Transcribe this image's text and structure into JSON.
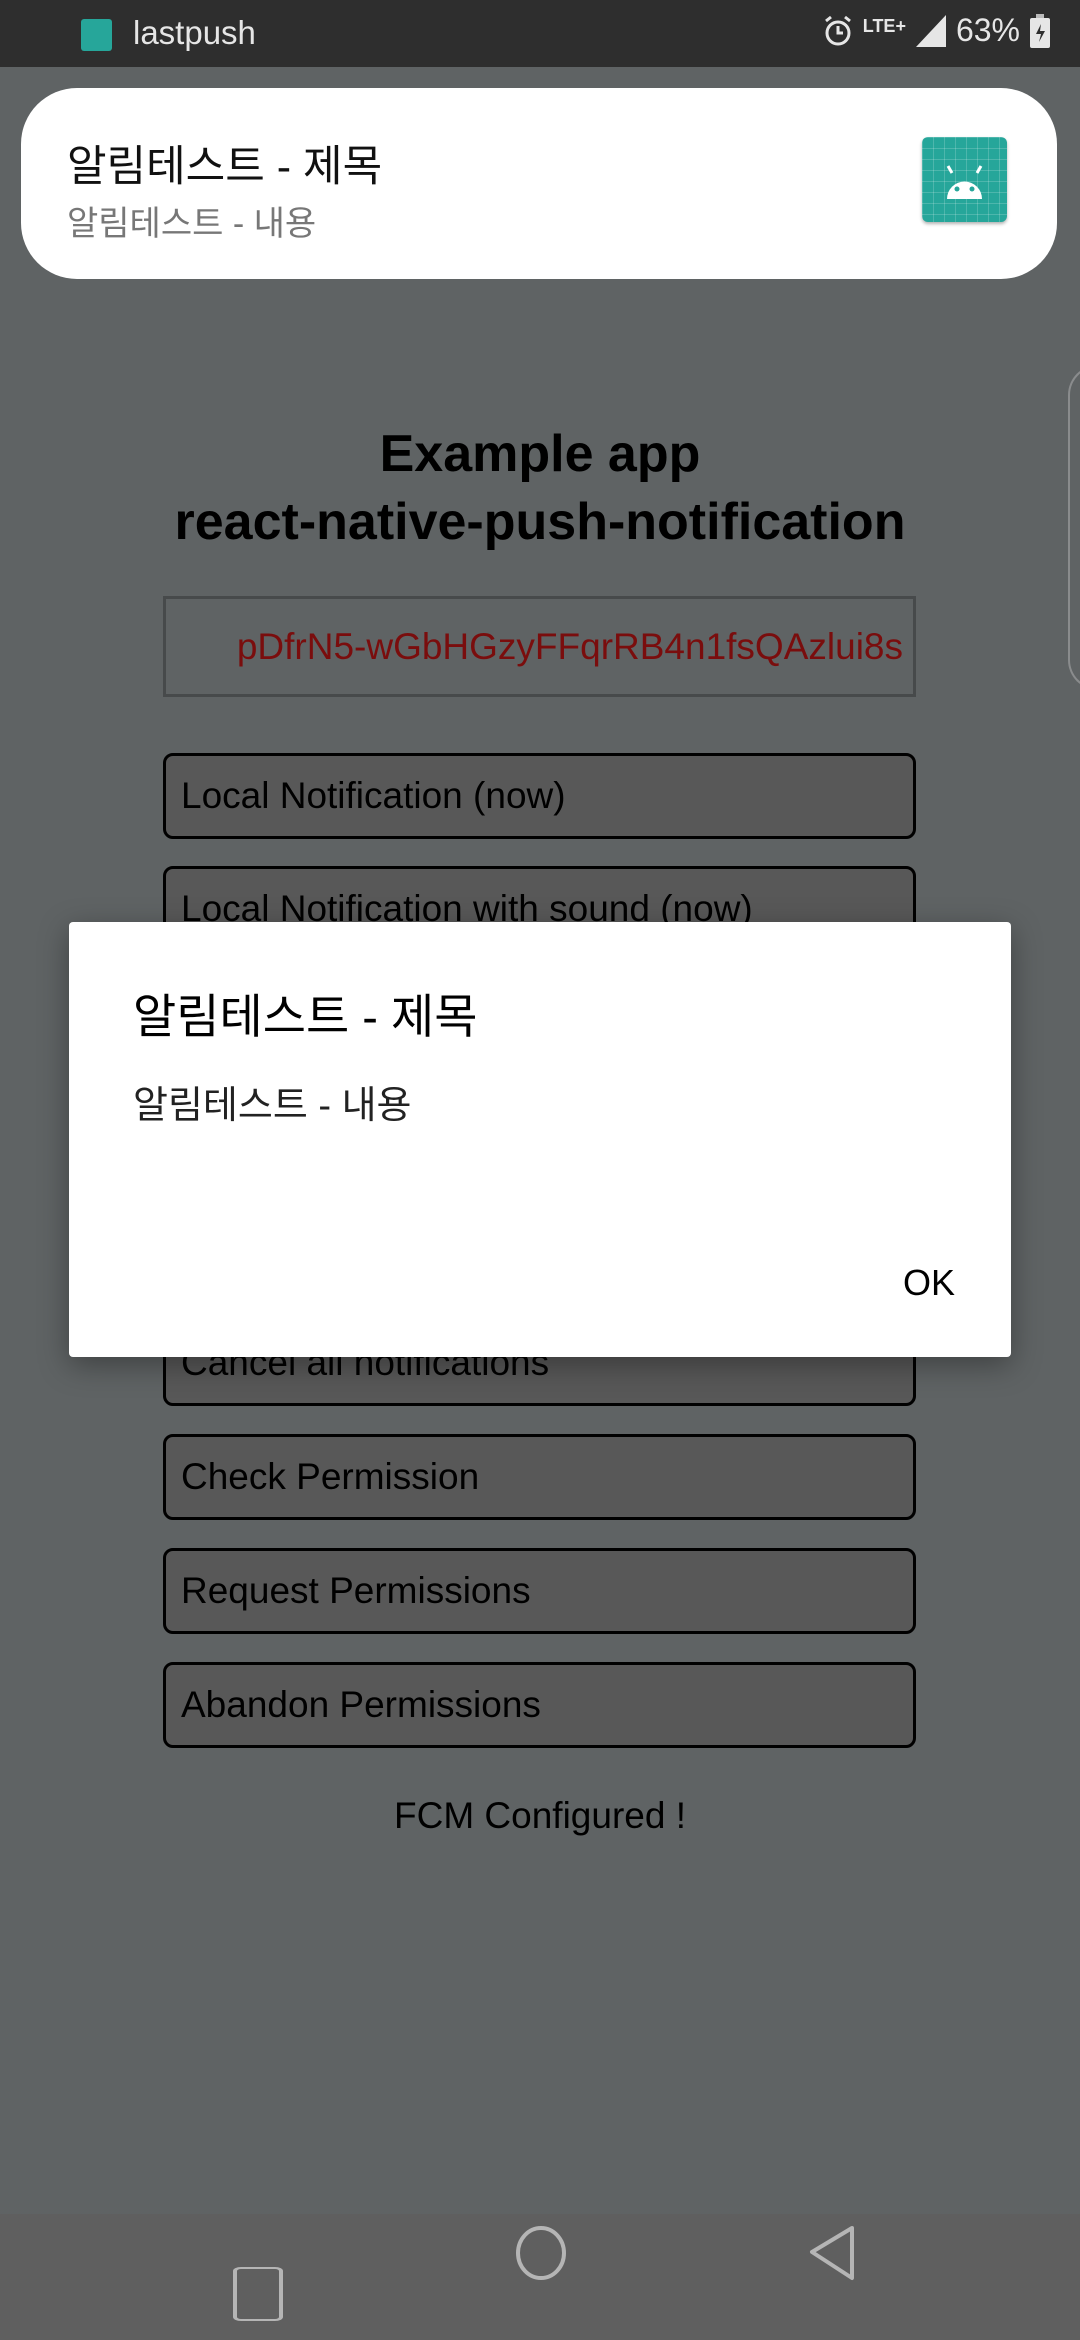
{
  "status_bar": {
    "app_name": "lastpush",
    "network": "LTE+",
    "battery": "63%",
    "icons": [
      "android-app-icon",
      "alarm-icon",
      "lte-icon",
      "signal-icon",
      "battery-charging-icon"
    ]
  },
  "notification": {
    "title": "알림테스트 - 제목",
    "content": "알림테스트 - 내용",
    "icon": "android-app-icon"
  },
  "app": {
    "title_line1": "Example app",
    "title_line2": "react-native-push-notification",
    "token": "pDfrN5-wGbHGzyFFqrRB4n1fsQAzlui8s",
    "token_color": "#7a0d0d",
    "buttons": [
      {
        "label": "Local Notification (now)"
      },
      {
        "label": "Local Notification with sound (now)"
      },
      {
        "label": ""
      },
      {
        "label": ""
      },
      {
        "label": ""
      },
      {
        "label": "Cancel all notifications"
      },
      {
        "label": "Check Permission"
      },
      {
        "label": "Request Permissions"
      },
      {
        "label": "Abandon Permissions"
      }
    ],
    "status": "FCM Configured !"
  },
  "dialog": {
    "title": "알림테스트 - 제목",
    "message": "알림테스트 - 내용",
    "ok_label": "OK"
  },
  "nav_bar": {
    "icons": [
      "recents-icon",
      "home-icon",
      "back-icon"
    ]
  }
}
